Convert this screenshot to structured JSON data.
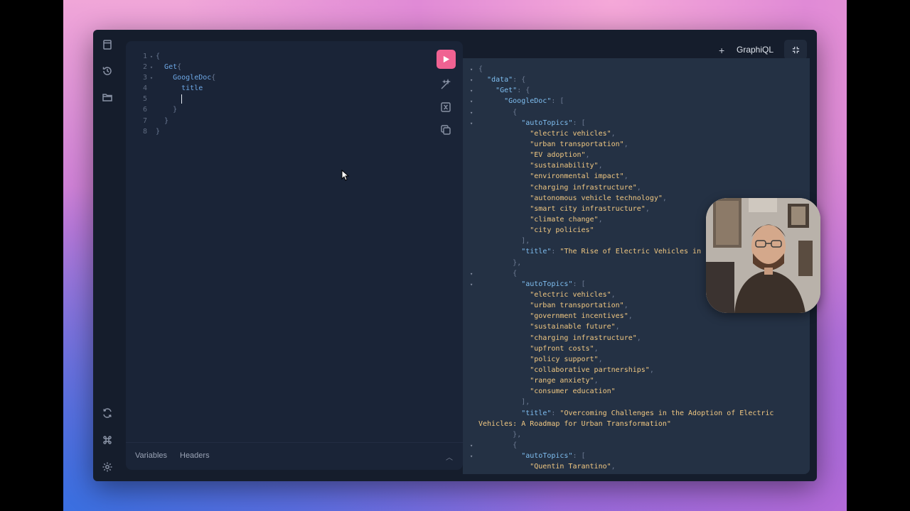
{
  "sidebar": {
    "icons": [
      "docs-icon",
      "history-icon",
      "folder-icon",
      "refresh-icon",
      "shortcut-icon",
      "settings-icon"
    ]
  },
  "editor": {
    "lines": [
      {
        "n": "1",
        "fold": "▾",
        "indent": "",
        "tokens": [
          {
            "t": "{",
            "c": "brace"
          }
        ]
      },
      {
        "n": "2",
        "fold": "▾",
        "indent": "  ",
        "tokens": [
          {
            "t": "Get",
            "c": "field"
          },
          {
            "t": "{",
            "c": "brace"
          }
        ]
      },
      {
        "n": "3",
        "fold": "▾",
        "indent": "    ",
        "tokens": [
          {
            "t": "GoogleDoc",
            "c": "field"
          },
          {
            "t": "{",
            "c": "brace"
          }
        ]
      },
      {
        "n": "4",
        "fold": "",
        "indent": "      ",
        "tokens": [
          {
            "t": "title",
            "c": "field"
          }
        ]
      },
      {
        "n": "5",
        "fold": "",
        "indent": "      ",
        "tokens": [],
        "caret": true
      },
      {
        "n": "6",
        "fold": "",
        "indent": "    ",
        "tokens": [
          {
            "t": "}",
            "c": "brace"
          }
        ]
      },
      {
        "n": "7",
        "fold": "",
        "indent": "  ",
        "tokens": [
          {
            "t": "}",
            "c": "brace"
          }
        ]
      },
      {
        "n": "8",
        "fold": "",
        "indent": "",
        "tokens": [
          {
            "t": "}",
            "c": "brace"
          }
        ]
      }
    ],
    "footer": {
      "variables": "Variables",
      "headers": "Headers"
    }
  },
  "header": {
    "plus": "+",
    "title": "GraphiQL"
  },
  "response": {
    "lines": [
      {
        "arrow": "▾",
        "indent": "",
        "parts": [
          {
            "t": "{",
            "c": "punct"
          }
        ]
      },
      {
        "arrow": "▾",
        "indent": "  ",
        "parts": [
          {
            "t": "\"data\"",
            "c": "key"
          },
          {
            "t": ": {",
            "c": "punct"
          }
        ]
      },
      {
        "arrow": "▾",
        "indent": "    ",
        "parts": [
          {
            "t": "\"Get\"",
            "c": "key"
          },
          {
            "t": ": {",
            "c": "punct"
          }
        ]
      },
      {
        "arrow": "▾",
        "indent": "      ",
        "parts": [
          {
            "t": "\"GoogleDoc\"",
            "c": "key"
          },
          {
            "t": ": [",
            "c": "punct"
          }
        ]
      },
      {
        "arrow": "▾",
        "indent": "        ",
        "parts": [
          {
            "t": "{",
            "c": "punct"
          }
        ]
      },
      {
        "arrow": "▾",
        "indent": "          ",
        "parts": [
          {
            "t": "\"autoTopics\"",
            "c": "key"
          },
          {
            "t": ": [",
            "c": "punct"
          }
        ]
      },
      {
        "arrow": "",
        "indent": "            ",
        "parts": [
          {
            "t": "\"electric vehicles\"",
            "c": "str"
          },
          {
            "t": ",",
            "c": "punct"
          }
        ]
      },
      {
        "arrow": "",
        "indent": "            ",
        "parts": [
          {
            "t": "\"urban transportation\"",
            "c": "str"
          },
          {
            "t": ",",
            "c": "punct"
          }
        ]
      },
      {
        "arrow": "",
        "indent": "            ",
        "parts": [
          {
            "t": "\"EV adoption\"",
            "c": "str"
          },
          {
            "t": ",",
            "c": "punct"
          }
        ]
      },
      {
        "arrow": "",
        "indent": "            ",
        "parts": [
          {
            "t": "\"sustainability\"",
            "c": "str"
          },
          {
            "t": ",",
            "c": "punct"
          }
        ]
      },
      {
        "arrow": "",
        "indent": "            ",
        "parts": [
          {
            "t": "\"environmental impact\"",
            "c": "str"
          },
          {
            "t": ",",
            "c": "punct"
          }
        ]
      },
      {
        "arrow": "",
        "indent": "            ",
        "parts": [
          {
            "t": "\"charging infrastructure\"",
            "c": "str"
          },
          {
            "t": ",",
            "c": "punct"
          }
        ]
      },
      {
        "arrow": "",
        "indent": "            ",
        "parts": [
          {
            "t": "\"autonomous vehicle technology\"",
            "c": "str"
          },
          {
            "t": ",",
            "c": "punct"
          }
        ]
      },
      {
        "arrow": "",
        "indent": "            ",
        "parts": [
          {
            "t": "\"smart city infrastructure\"",
            "c": "str"
          },
          {
            "t": ",",
            "c": "punct"
          }
        ]
      },
      {
        "arrow": "",
        "indent": "            ",
        "parts": [
          {
            "t": "\"climate change\"",
            "c": "str"
          },
          {
            "t": ",",
            "c": "punct"
          }
        ]
      },
      {
        "arrow": "",
        "indent": "            ",
        "parts": [
          {
            "t": "\"city policies\"",
            "c": "str"
          }
        ]
      },
      {
        "arrow": "",
        "indent": "          ",
        "parts": [
          {
            "t": "],",
            "c": "punct"
          }
        ]
      },
      {
        "arrow": "",
        "indent": "          ",
        "parts": [
          {
            "t": "\"title\"",
            "c": "key"
          },
          {
            "t": ": ",
            "c": "punct"
          },
          {
            "t": "\"The Rise of Electric Vehicles in",
            "c": "str"
          }
        ]
      },
      {
        "arrow": "",
        "indent": "        ",
        "parts": [
          {
            "t": "},",
            "c": "punct"
          }
        ]
      },
      {
        "arrow": "▾",
        "indent": "        ",
        "parts": [
          {
            "t": "{",
            "c": "punct"
          }
        ]
      },
      {
        "arrow": "▾",
        "indent": "          ",
        "parts": [
          {
            "t": "\"autoTopics\"",
            "c": "key"
          },
          {
            "t": ": [",
            "c": "punct"
          }
        ]
      },
      {
        "arrow": "",
        "indent": "            ",
        "parts": [
          {
            "t": "\"electric vehicles\"",
            "c": "str"
          },
          {
            "t": ",",
            "c": "punct"
          }
        ]
      },
      {
        "arrow": "",
        "indent": "            ",
        "parts": [
          {
            "t": "\"urban transportation\"",
            "c": "str"
          },
          {
            "t": ",",
            "c": "punct"
          }
        ]
      },
      {
        "arrow": "",
        "indent": "            ",
        "parts": [
          {
            "t": "\"government incentives\"",
            "c": "str"
          },
          {
            "t": ",",
            "c": "punct"
          }
        ]
      },
      {
        "arrow": "",
        "indent": "            ",
        "parts": [
          {
            "t": "\"sustainable future\"",
            "c": "str"
          },
          {
            "t": ",",
            "c": "punct"
          }
        ]
      },
      {
        "arrow": "",
        "indent": "            ",
        "parts": [
          {
            "t": "\"charging infrastructure\"",
            "c": "str"
          },
          {
            "t": ",",
            "c": "punct"
          }
        ]
      },
      {
        "arrow": "",
        "indent": "            ",
        "parts": [
          {
            "t": "\"upfront costs\"",
            "c": "str"
          },
          {
            "t": ",",
            "c": "punct"
          }
        ]
      },
      {
        "arrow": "",
        "indent": "            ",
        "parts": [
          {
            "t": "\"policy support\"",
            "c": "str"
          },
          {
            "t": ",",
            "c": "punct"
          }
        ]
      },
      {
        "arrow": "",
        "indent": "            ",
        "parts": [
          {
            "t": "\"collaborative partnerships\"",
            "c": "str"
          },
          {
            "t": ",",
            "c": "punct"
          }
        ]
      },
      {
        "arrow": "",
        "indent": "            ",
        "parts": [
          {
            "t": "\"range anxiety\"",
            "c": "str"
          },
          {
            "t": ",",
            "c": "punct"
          }
        ]
      },
      {
        "arrow": "",
        "indent": "            ",
        "parts": [
          {
            "t": "\"consumer education\"",
            "c": "str"
          }
        ]
      },
      {
        "arrow": "",
        "indent": "          ",
        "parts": [
          {
            "t": "],",
            "c": "punct"
          }
        ]
      },
      {
        "arrow": "",
        "indent": "          ",
        "parts": [
          {
            "t": "\"title\"",
            "c": "key"
          },
          {
            "t": ": ",
            "c": "punct"
          },
          {
            "t": "\"Overcoming Challenges in the Adoption of Electric",
            "c": "str"
          }
        ]
      },
      {
        "arrow": "",
        "indent": "",
        "parts": [
          {
            "t": "Vehicles: A Roadmap for Urban Transformation\"",
            "c": "str"
          }
        ]
      },
      {
        "arrow": "",
        "indent": "        ",
        "parts": [
          {
            "t": "},",
            "c": "punct"
          }
        ]
      },
      {
        "arrow": "▾",
        "indent": "        ",
        "parts": [
          {
            "t": "{",
            "c": "punct"
          }
        ]
      },
      {
        "arrow": "▾",
        "indent": "          ",
        "parts": [
          {
            "t": "\"autoTopics\"",
            "c": "key"
          },
          {
            "t": ": [",
            "c": "punct"
          }
        ]
      },
      {
        "arrow": "",
        "indent": "            ",
        "parts": [
          {
            "t": "\"Quentin Tarantino\"",
            "c": "str"
          },
          {
            "t": ",",
            "c": "punct"
          }
        ]
      }
    ]
  },
  "colors": {
    "run_button": "#f06292",
    "window_bg": "#151d2c",
    "editor_bg": "#1a2437",
    "results_bg": "#243144"
  }
}
